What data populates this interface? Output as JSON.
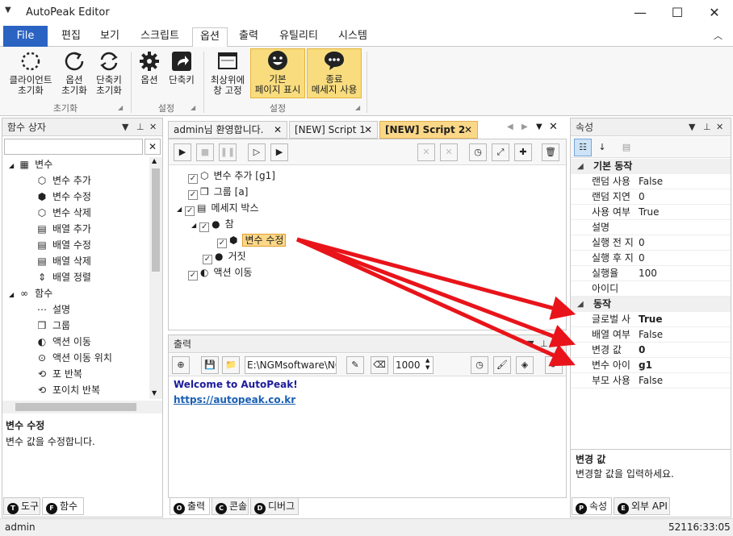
{
  "app": {
    "title": "AutoPeak Editor"
  },
  "window": {
    "minimize": "—",
    "maximize": "☐",
    "close": "✕"
  },
  "ribbon_tabs": [
    "File",
    "편집",
    "보기",
    "스크립트",
    "옵션",
    "출력",
    "유틸리티",
    "시스템"
  ],
  "ribbon": {
    "buttons": [
      {
        "label1": "클라이언트",
        "label2": "초기화"
      },
      {
        "label1": "옵션",
        "label2": "초기화"
      },
      {
        "label1": "단축키",
        "label2": "초기화"
      },
      {
        "label1": "옵션",
        "label2": ""
      },
      {
        "label1": "단축키",
        "label2": ""
      },
      {
        "label1": "최상위에",
        "label2": "창 고정"
      },
      {
        "label1": "기본",
        "label2": "페이지 표시"
      },
      {
        "label1": "종료",
        "label2": "메세지 사용"
      }
    ],
    "groups": [
      "초기화",
      "설정",
      "설정"
    ]
  },
  "left_panel": {
    "title": "함수 상자",
    "clear": "✕",
    "tree": [
      {
        "label": "변수",
        "level": 0,
        "icon": "cube-group-icon"
      },
      {
        "label": "변수 추가",
        "level": 1,
        "icon": "cube-add-icon"
      },
      {
        "label": "변수 수정",
        "level": 1,
        "icon": "cube-edit-icon"
      },
      {
        "label": "변수 삭제",
        "level": 1,
        "icon": "cube-delete-icon"
      },
      {
        "label": "배열 추가",
        "level": 1,
        "icon": "array-add-icon"
      },
      {
        "label": "배열 수정",
        "level": 1,
        "icon": "array-edit-icon"
      },
      {
        "label": "배열 삭제",
        "level": 1,
        "icon": "array-delete-icon"
      },
      {
        "label": "배열 정렬",
        "level": 1,
        "icon": "sort-icon"
      },
      {
        "label": "함수",
        "level": 0,
        "icon": "infinity-icon"
      },
      {
        "label": "설명",
        "level": 1,
        "icon": "comment-icon"
      },
      {
        "label": "그룹",
        "level": 1,
        "icon": "group-icon"
      },
      {
        "label": "액션 이동",
        "level": 1,
        "icon": "goto-icon"
      },
      {
        "label": "액션 이동 위치",
        "level": 1,
        "icon": "target-icon"
      },
      {
        "label": "포 반복",
        "level": 1,
        "icon": "loop-icon"
      },
      {
        "label": "포이치 반복",
        "level": 1,
        "icon": "foreach-icon"
      }
    ],
    "desc_title": "변수 수정",
    "desc_text": "변수 값을 수정합니다.",
    "tabs": [
      "도구",
      "함수"
    ]
  },
  "doc_tabs": [
    {
      "label": "admin님 환영합니다."
    },
    {
      "label": "[NEW] Script 1"
    },
    {
      "label": "[NEW] Script 2"
    }
  ],
  "script": {
    "lines": [
      {
        "text": "변수 추가 [g1]",
        "indent": 0,
        "check": "✓",
        "icon": "cube-add-icon"
      },
      {
        "text": "그룹 [a]",
        "indent": 0,
        "check": "✓",
        "icon": "group-icon"
      },
      {
        "text": "메세지 박스",
        "indent": 0,
        "check": "✓",
        "icon": "message-box-icon"
      },
      {
        "text": "참",
        "indent": 1,
        "check": "✓",
        "icon": "true-icon"
      },
      {
        "text": "변수 수정",
        "indent": 2,
        "check": "✓",
        "icon": "cube-edit-icon"
      },
      {
        "text": "거짓",
        "indent": 1,
        "check": "✓",
        "icon": "false-icon"
      },
      {
        "text": "액션 이동",
        "indent": 0,
        "check": "✓",
        "icon": "goto-icon"
      }
    ]
  },
  "output": {
    "title": "출력",
    "path": "E:\\NGMsoftware\\NG",
    "number": "1000",
    "welcome": "Welcome to AutoPeak!",
    "link": "https://autopeak.co.kr",
    "tabs": [
      "출력",
      "콘솔",
      "디버그"
    ]
  },
  "properties": {
    "title": "속성",
    "categories": [
      {
        "name": "기본 동작",
        "rows": [
          {
            "name": "랜덤 사용",
            "value": "False",
            "bold": false
          },
          {
            "name": "랜덤 지연",
            "value": "0",
            "bold": false
          },
          {
            "name": "사용 여부",
            "value": "True",
            "bold": false
          },
          {
            "name": "설명",
            "value": "",
            "bold": false
          },
          {
            "name": "실행 전 지",
            "value": "0",
            "bold": false
          },
          {
            "name": "실행 후 지",
            "value": "0",
            "bold": false
          },
          {
            "name": "실행율",
            "value": "100",
            "bold": false
          },
          {
            "name": "아이디",
            "value": "",
            "bold": false
          }
        ]
      },
      {
        "name": "동작",
        "rows": [
          {
            "name": "글로벌 사",
            "value": "True",
            "bold": true
          },
          {
            "name": "배열 여부",
            "value": "False",
            "bold": false
          },
          {
            "name": "변경 값",
            "value": "0",
            "bold": true
          },
          {
            "name": "변수 아이",
            "value": "g1",
            "bold": true
          },
          {
            "name": "부모 사용",
            "value": "False",
            "bold": false
          }
        ]
      }
    ],
    "desc_title": "변경 값",
    "desc_text": "변경할 값을 입력하세요.",
    "tabs": [
      "속성",
      "외부 API"
    ]
  },
  "status": {
    "user": "admin",
    "time": "52116:33:05"
  },
  "colors": {
    "accent": "#2b63c3",
    "highlight": "#f8dc7e",
    "arrow": "#e8141a"
  }
}
